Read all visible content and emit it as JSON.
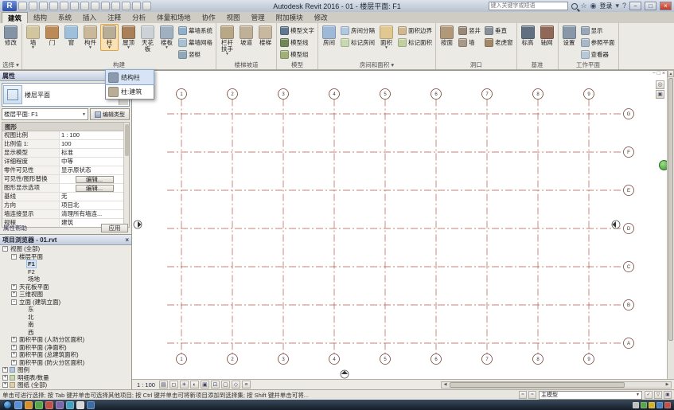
{
  "titlebar": {
    "logo": "R",
    "title": "Autodesk Revit 2016 - 01 - 楼层平面: F1",
    "search_placeholder": "键入关键字或短语",
    "signin": "登录",
    "qat_icons": [
      "open-icon",
      "save-icon",
      "sync-icon",
      "undo-icon",
      "redo-icon",
      "print-icon",
      "measure-icon",
      "aligned-dimension-icon",
      "tag-by-category-icon",
      "text-icon",
      "default-3d-view-icon",
      "section-icon",
      "thin-lines-icon"
    ]
  },
  "ribbon": {
    "tabs": [
      {
        "label": "建筑",
        "active": true
      },
      {
        "label": "结构"
      },
      {
        "label": "系统"
      },
      {
        "label": "插入"
      },
      {
        "label": "注释"
      },
      {
        "label": "分析"
      },
      {
        "label": "体量和场地"
      },
      {
        "label": "协作"
      },
      {
        "label": "视图"
      },
      {
        "label": "管理"
      },
      {
        "label": "附加模块"
      },
      {
        "label": "修改"
      }
    ],
    "panels": [
      {
        "name": "选择 ▾",
        "cells": [
          {
            "label": "修改",
            "icon": "modify-cursor-icon",
            "color": "#8494a6"
          }
        ]
      },
      {
        "name": "构建",
        "cells": [
          {
            "label": "墙",
            "icon": "wall-icon",
            "color": "#d2c69e",
            "arrow": true
          },
          {
            "label": "门",
            "icon": "door-icon",
            "color": "#bb8a57"
          },
          {
            "label": "窗",
            "icon": "window-icon",
            "color": "#9fc0da"
          },
          {
            "label": "构件",
            "icon": "component-icon",
            "color": "#cbb89a",
            "arrow": true
          },
          {
            "label": "柱",
            "icon": "column-icon",
            "color": "#b8ad96",
            "arrow": true,
            "active": true
          },
          {
            "label": "屋顶",
            "icon": "roof-icon",
            "color": "#a9805a",
            "arrow": true
          },
          {
            "label": "天花板",
            "icon": "ceiling-icon",
            "color": "#ccd2d8"
          },
          {
            "label": "楼板",
            "icon": "floor-icon",
            "color": "#9fb0c0",
            "arrow": true
          },
          {
            "stack": [
              {
                "label": "幕墙系统",
                "icon": "curtain-system-icon",
                "color": "#8fb0c8"
              },
              {
                "label": "幕墙网格",
                "icon": "curtain-grid-icon",
                "color": "#a8c0d0"
              },
              {
                "label": "竖梃",
                "icon": "mullion-icon",
                "color": "#90a8b8"
              }
            ]
          }
        ]
      },
      {
        "name": "楼梯坡道",
        "cells": [
          {
            "label": "栏杆扶手",
            "icon": "railing-icon",
            "color": "#b8a888",
            "arrow": true
          },
          {
            "label": "坡道",
            "icon": "ramp-icon",
            "color": "#c0b098"
          },
          {
            "label": "楼梯",
            "icon": "stair-icon",
            "color": "#c8b8a0"
          }
        ]
      },
      {
        "name": "模型",
        "cells": [
          {
            "stack": [
              {
                "label": "模型文字",
                "icon": "model-text-icon",
                "color": "#607890"
              },
              {
                "label": "模型线",
                "icon": "model-line-icon",
                "color": "#708858"
              },
              {
                "label": "模型组",
                "icon": "model-group-icon",
                "color": "#a0b078"
              }
            ]
          }
        ]
      },
      {
        "name": "房间和面积 ▾",
        "cells": [
          {
            "label": "房间",
            "icon": "room-icon",
            "color": "#9fb8d8"
          },
          {
            "stack": [
              {
                "label": "房间分隔",
                "icon": "room-separator-icon",
                "color": "#b0c8e0"
              },
              {
                "label": "标记房间",
                "icon": "tag-room-icon",
                "color": "#c8d8b0"
              }
            ]
          },
          {
            "label": "面积",
            "icon": "area-icon",
            "color": "#e0c890",
            "arrow": true
          },
          {
            "stack": [
              {
                "label": "面积边界",
                "icon": "area-boundary-icon",
                "color": "#d0b890"
              },
              {
                "label": "标记面积",
                "icon": "tag-area-icon",
                "color": "#c0d0a0"
              }
            ]
          }
        ]
      },
      {
        "name": "洞口",
        "cells": [
          {
            "label": "按面",
            "icon": "opening-by-face-icon",
            "color": "#b09878"
          },
          {
            "stack": [
              {
                "label": "竖井",
                "icon": "shaft-opening-icon",
                "color": "#988878"
              },
              {
                "label": "墙",
                "icon": "wall-opening-icon",
                "color": "#a89888"
              }
            ]
          },
          {
            "stack": [
              {
                "label": "垂直",
                "icon": "vertical-opening-icon",
                "color": "#889098"
              },
              {
                "label": "老虎窗",
                "icon": "dormer-opening-icon",
                "color": "#a08868"
              }
            ]
          }
        ]
      },
      {
        "name": "基准",
        "cells": [
          {
            "label": "标高",
            "icon": "level-icon",
            "color": "#607080"
          },
          {
            "label": "轴网",
            "icon": "grid-icon",
            "color": "#906858"
          }
        ]
      },
      {
        "name": "工作平面",
        "cells": [
          {
            "label": "设置",
            "icon": "set-work-plane-icon",
            "color": "#8898a8"
          },
          {
            "stack": [
              {
                "label": "显示",
                "icon": "show-work-plane-icon",
                "color": "#98a8b8"
              },
              {
                "label": "参照平面",
                "icon": "ref-plane-icon",
                "color": "#a8b8c8"
              },
              {
                "label": "查看器",
                "icon": "viewer-icon",
                "color": "#b8c8d8"
              }
            ]
          }
        ]
      }
    ]
  },
  "column_dropdown": {
    "items": [
      {
        "label": "结构柱",
        "icon": "structural-column-icon",
        "color": "#8a9bb0",
        "hover": true
      },
      {
        "label": "柱:建筑",
        "icon": "architectural-column-icon",
        "color": "#b8ad96"
      }
    ]
  },
  "properties": {
    "title": "属性",
    "type_selector": "楼层平面",
    "instance_selector": "楼层平面: F1",
    "edit_type_label": "编辑类型",
    "section": "图形",
    "rows": [
      {
        "label": "视图比例",
        "value": "1 : 100"
      },
      {
        "label": "比例值 1:",
        "value": "100"
      },
      {
        "label": "显示模型",
        "value": "标准"
      },
      {
        "label": "详细程度",
        "value": "中等"
      },
      {
        "label": "零件可见性",
        "value": "显示原状态"
      },
      {
        "label": "可见性/图形替换",
        "value": "编辑...",
        "button": true
      },
      {
        "label": "图形显示选项",
        "value": "编辑...",
        "button": true
      },
      {
        "label": "基线",
        "value": "无"
      },
      {
        "label": "方向",
        "value": "项目北"
      },
      {
        "label": "墙连接显示",
        "value": "清理所有墙连..."
      },
      {
        "label": "规程",
        "value": "建筑"
      }
    ],
    "help_label": "属性帮助",
    "apply_label": "应用"
  },
  "project_browser": {
    "title": "项目浏览器 - 01.rvt",
    "tree": [
      {
        "label": "视图 (全部)",
        "level": 0,
        "expander": "-"
      },
      {
        "label": "楼层平面",
        "level": 1,
        "expander": "-"
      },
      {
        "label": "F1",
        "level": 2,
        "selected": true
      },
      {
        "label": "F2",
        "level": 2
      },
      {
        "label": "场地",
        "level": 2
      },
      {
        "label": "天花板平面",
        "level": 1,
        "expander": "+"
      },
      {
        "label": "三维视图",
        "level": 1,
        "expander": "+"
      },
      {
        "label": "立面 (建筑立面)",
        "level": 1,
        "expander": "-"
      },
      {
        "label": "东",
        "level": 2
      },
      {
        "label": "北",
        "level": 2
      },
      {
        "label": "南",
        "level": 2
      },
      {
        "label": "西",
        "level": 2
      },
      {
        "label": "面积平面 (人防分区面积)",
        "level": 1,
        "expander": "+"
      },
      {
        "label": "面积平面 (净面积)",
        "level": 1,
        "expander": "+"
      },
      {
        "label": "面积平面 (总建筑面积)",
        "level": 1,
        "expander": "+"
      },
      {
        "label": "面积平面 (防火分区面积)",
        "level": 1,
        "expander": "+"
      },
      {
        "label": "图例",
        "level": 0,
        "expander": "+",
        "icon": "legend-icon",
        "icon_color": "#b0c8e0"
      },
      {
        "label": "明细表/数量",
        "level": 0,
        "expander": "+",
        "icon": "schedule-icon",
        "icon_color": "#c8d8b0"
      },
      {
        "label": "图纸 (全部)",
        "level": 0,
        "expander": "+",
        "icon": "sheet-icon",
        "icon_color": "#e0d0a8"
      }
    ]
  },
  "canvas": {
    "grid": {
      "column_labels": [
        "1",
        "2",
        "3",
        "4",
        "5",
        "6",
        "7",
        "8",
        "9"
      ],
      "row_labels": [
        "G",
        "F",
        "E",
        "D",
        "C",
        "B",
        "A"
      ],
      "line_color": "#b4574a",
      "bubble_stroke": "#7c4237"
    },
    "elevation_markers": [
      "west",
      "east",
      "south"
    ],
    "view_window_buttons": [
      "minimize",
      "restore",
      "close"
    ]
  },
  "view_bar": {
    "scale": "1 : 100",
    "icons": [
      "detail-level-icon",
      "visual-style-icon",
      "sun-path-icon",
      "shadows-icon",
      "rendering-icon",
      "crop-view-icon",
      "show-crop-region-icon",
      "temporary-hide-isolate-icon",
      "reveal-hidden-elements-icon"
    ],
    "icon_glyphs": [
      "▤",
      "◻",
      "☀",
      "◐",
      "▣",
      "⊡",
      "▢",
      "◇",
      "≡"
    ]
  },
  "status_bar": {
    "hint": "单击可进行选择; 按 Tab 键并单击可选择其他项目; 按 Ctrl 键并单击可将新项目添加到选择集; 按 Shift 键并单击可将...",
    "main_model": "主模型",
    "left_icons": [
      "worksets-icon",
      "design-options-icon"
    ],
    "right_icons": [
      "editable-only-icon",
      "filter-icon",
      "select-toggle-icon"
    ]
  },
  "taskbar": {
    "app_icon_colors": [
      "#5a8fd4",
      "#d4902a",
      "#58a54a",
      "#c05048",
      "#7a68a8",
      "#48a0c0",
      "#d8d8d8",
      "#3a6ea5"
    ],
    "tray_icon_colors": [
      "#c0c0c0",
      "#58a54a",
      "#d4b02a",
      "#4a80c0",
      "#c05048"
    ]
  }
}
